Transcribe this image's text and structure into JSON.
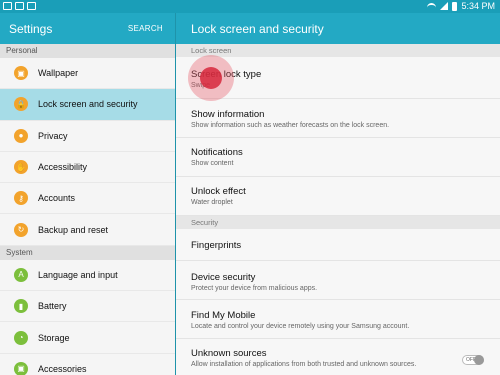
{
  "status_bar": {
    "time": "5:34 PM"
  },
  "left_header": {
    "title": "Settings",
    "search": "SEARCH"
  },
  "right_header": {
    "title": "Lock screen and security"
  },
  "left_nav": {
    "section_personal": "Personal",
    "personal_items": [
      {
        "label": "Wallpaper",
        "icon": "image-icon",
        "color": "#f2a32c"
      },
      {
        "label": "Lock screen and security",
        "icon": "lock-icon",
        "color": "#f2a32c"
      },
      {
        "label": "Privacy",
        "icon": "privacy-icon",
        "color": "#f2a32c"
      },
      {
        "label": "Accessibility",
        "icon": "hand-icon",
        "color": "#f2a32c"
      },
      {
        "label": "Accounts",
        "icon": "key-icon",
        "color": "#f2a32c"
      },
      {
        "label": "Backup and reset",
        "icon": "backup-icon",
        "color": "#f2a32c"
      }
    ],
    "section_system": "System",
    "system_items": [
      {
        "label": "Language and input",
        "icon": "language-icon",
        "color": "#7cbf3c"
      },
      {
        "label": "Battery",
        "icon": "battery-icon",
        "color": "#7cbf3c"
      },
      {
        "label": "Storage",
        "icon": "storage-icon",
        "color": "#7cbf3c"
      },
      {
        "label": "Accessories",
        "icon": "accessories-icon",
        "color": "#7cbf3c"
      }
    ]
  },
  "right_panel": {
    "section_lock": "Lock screen",
    "lock_items": [
      {
        "title": "Screen lock type",
        "sub": "Swipe"
      },
      {
        "title": "Show information",
        "sub": "Show information such as weather forecasts on the lock screen."
      },
      {
        "title": "Notifications",
        "sub": "Show content"
      },
      {
        "title": "Unlock effect",
        "sub": "Water droplet"
      }
    ],
    "section_security": "Security",
    "security_items": [
      {
        "title": "Fingerprints",
        "sub": ""
      },
      {
        "title": "Device security",
        "sub": "Protect your device from malicious apps."
      },
      {
        "title": "Find My Mobile",
        "sub": "Locate and control your device remotely using your Samsung account."
      },
      {
        "title": "Unknown sources",
        "sub": "Allow installation of applications from both trusted and unknown sources."
      }
    ],
    "unknown_sources_toggle": "OFF"
  },
  "colors": {
    "accent": "#23a9c4",
    "active_row": "#a6dce7"
  }
}
